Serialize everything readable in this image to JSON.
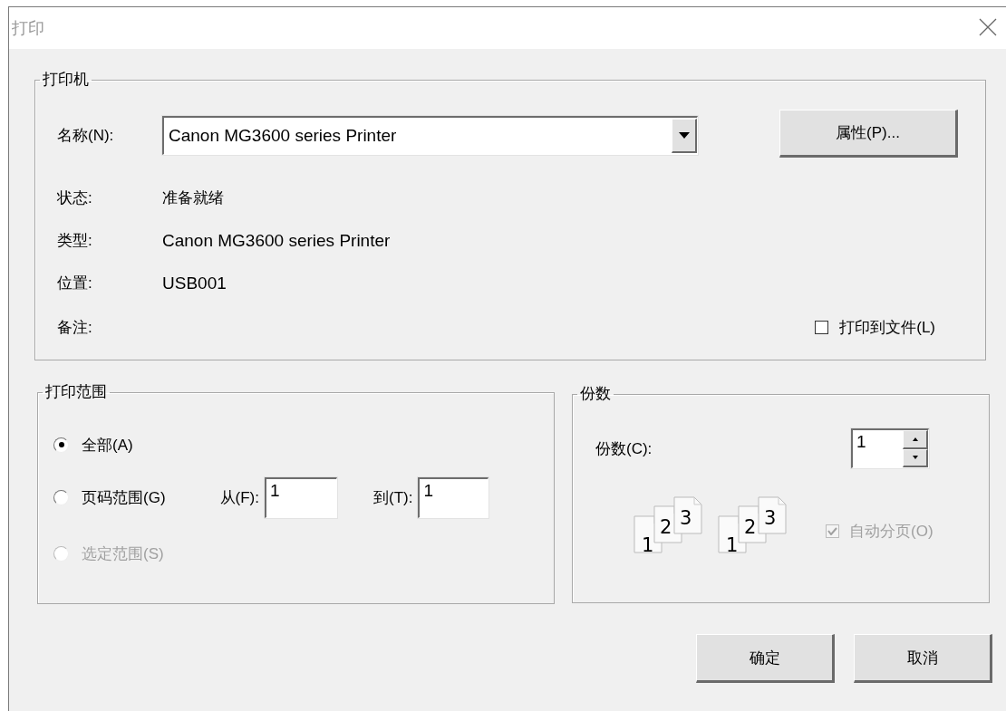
{
  "window": {
    "title": "打印"
  },
  "printer": {
    "legend": "打印机",
    "name_label": "名称(N):",
    "name_value": "Canon MG3600 series Printer",
    "properties_button": "属性(P)...",
    "info": [
      {
        "label": "状态:",
        "value": "准备就绪"
      },
      {
        "label": "类型:",
        "value": "Canon MG3600 series Printer"
      },
      {
        "label": "位置:",
        "value": "USB001"
      },
      {
        "label": "备注:"
      }
    ],
    "print_to_file": {
      "label": "打印到文件(L)",
      "checked": false
    }
  },
  "print_range": {
    "legend": "打印范围",
    "options": [
      {
        "label": "全部(A)",
        "selected": true,
        "disabled": false
      },
      {
        "label": "页码范围(G)",
        "selected": false,
        "disabled": false
      },
      {
        "label": "选定范围(S)",
        "selected": false,
        "disabled": true
      }
    ],
    "from_label": "从(F):",
    "from_value": "1",
    "to_label": "到(T):",
    "to_value": "1"
  },
  "copies": {
    "legend": "份数",
    "count_label": "份数(C):",
    "count_value": "1",
    "collate_stacks": [
      {
        "pages": [
          "1",
          "2",
          "3"
        ]
      },
      {
        "pages": [
          "1",
          "2",
          "3"
        ]
      }
    ],
    "collate": {
      "label": "自动分页(O)",
      "checked": true,
      "disabled": true
    }
  },
  "buttons": [
    "确定",
    "取消"
  ]
}
